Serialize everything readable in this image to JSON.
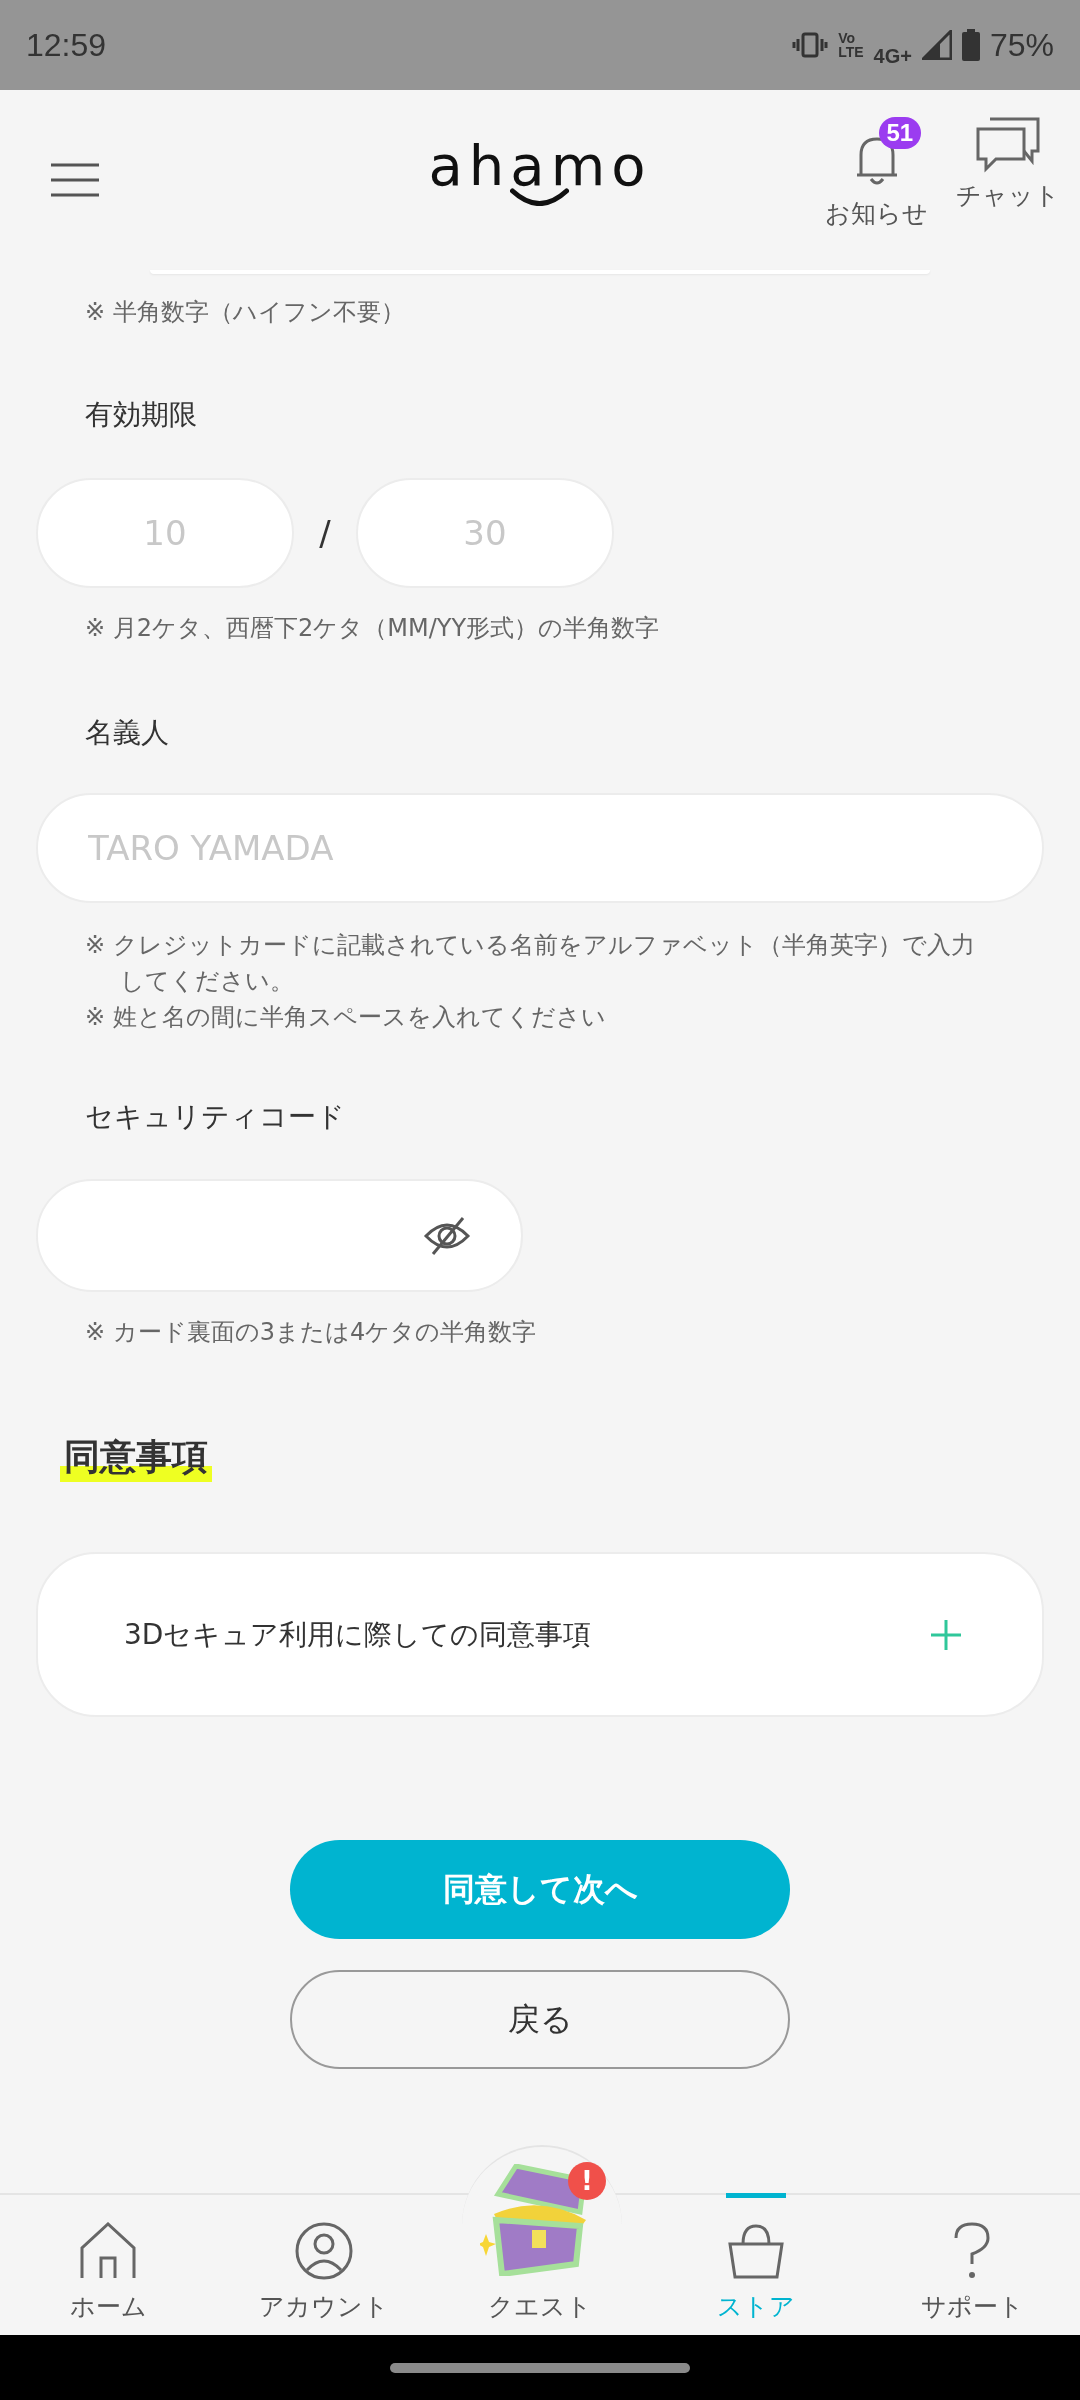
{
  "status_bar": {
    "time": "12:59",
    "volte": [
      "Vo",
      "LTE"
    ],
    "network": "4G+",
    "battery": "75%"
  },
  "header": {
    "logo": "ahamo",
    "notifications": {
      "label": "お知らせ",
      "badge": "51"
    },
    "chat": {
      "label": "チャット"
    }
  },
  "card_number_hint": "※ 半角数字（ハイフン不要）",
  "expiry": {
    "label": "有効期限",
    "month_placeholder": "10",
    "separator": "/",
    "year_placeholder": "30",
    "hint": "※ 月2ケタ、西暦下2ケタ（MM/YY形式）の半角数字"
  },
  "holder": {
    "label": "名義人",
    "placeholder": "TARO YAMADA",
    "hints": [
      "※ クレジットカードに記載されている名前をアルファベット（半角英字）で入力してください。",
      "※ 姓と名の間に半角スペースを入れてください"
    ]
  },
  "security_code": {
    "label": "セキュリティコード",
    "hint": "※ カード裏面の3または4ケタの半角数字"
  },
  "consent": {
    "heading": "同意事項",
    "items": [
      {
        "title": "3Dセキュア利用に際しての同意事項",
        "expanded": false
      }
    ]
  },
  "buttons": {
    "primary": "同意して次へ",
    "secondary": "戻る"
  },
  "bottom_nav": [
    {
      "kind": "home",
      "label": "ホーム",
      "selected": false
    },
    {
      "kind": "account",
      "label": "アカウント",
      "selected": false
    },
    {
      "kind": "quest",
      "label": "クエスト",
      "selected": false,
      "badge": "!"
    },
    {
      "kind": "store",
      "label": "ストア",
      "selected": true
    },
    {
      "kind": "support",
      "label": "サポート",
      "selected": false
    }
  ]
}
